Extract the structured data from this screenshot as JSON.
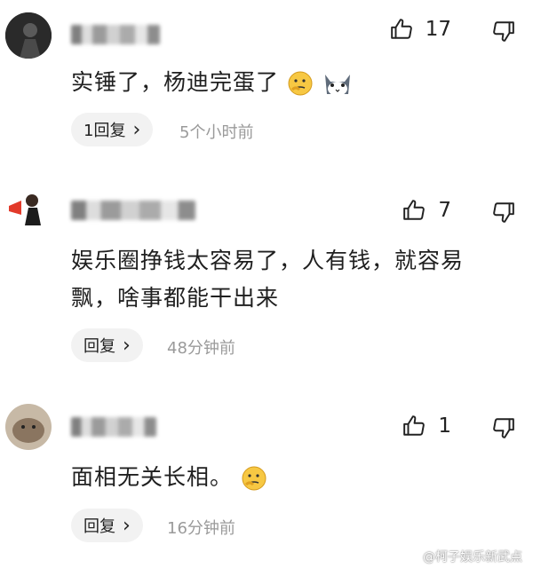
{
  "comments": [
    {
      "like_count": "17",
      "text": "实锤了，杨迪完蛋了",
      "reply_label": "1回复",
      "reply_chevron": "›",
      "time": "5个小时前",
      "emojis": [
        "thinking-emoji",
        "cat-emoji"
      ]
    },
    {
      "like_count": "7",
      "text": "娱乐圈挣钱太容易了，人有钱，就容易飘，啥事都能干出来",
      "reply_label": "回复",
      "reply_chevron": "›",
      "time": "48分钟前"
    },
    {
      "like_count": "1",
      "text": "面相无关长相。",
      "reply_label": "回复",
      "reply_chevron": "›",
      "time": "16分钟前",
      "emojis": [
        "thinking-emoji"
      ]
    }
  ],
  "watermark": "@柯子娱乐新武点",
  "icons": [
    "thumbs-up-icon",
    "thumbs-down-icon",
    "chevron-right-icon"
  ],
  "colors": {
    "text": "#1f1f1f",
    "muted": "#9a9a9a",
    "pill": "#f2f2f2"
  }
}
